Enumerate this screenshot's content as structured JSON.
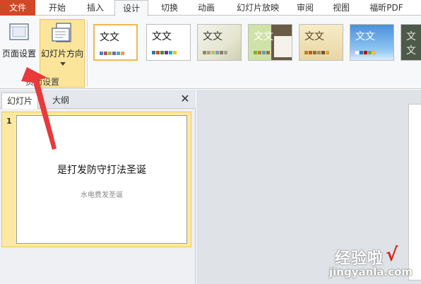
{
  "ribbon": {
    "tabs": [
      {
        "label": "文件"
      },
      {
        "label": "开始"
      },
      {
        "label": "插入"
      },
      {
        "label": "设计"
      },
      {
        "label": "切换"
      },
      {
        "label": "动画"
      },
      {
        "label": "幻灯片放映"
      },
      {
        "label": "审阅"
      },
      {
        "label": "视图"
      },
      {
        "label": "福昕PDF"
      }
    ],
    "active_tab": "设计",
    "page_setup_label": "页面设置",
    "orientation_label": "幻灯片方向",
    "group_label": "页面设置",
    "themes": [
      {
        "text": "文文"
      },
      {
        "text": "文文"
      },
      {
        "text": "文文"
      },
      {
        "text": "文文"
      },
      {
        "text": "文文"
      },
      {
        "text": "文文"
      },
      {
        "text": "文文"
      }
    ]
  },
  "panel": {
    "tabs": [
      {
        "label": "幻灯片"
      },
      {
        "label": "大纲"
      }
    ],
    "close_glyph": "✕"
  },
  "slides": [
    {
      "number": "1",
      "title": "是打发防守打法圣诞",
      "subtitle": "水电费发圣诞"
    }
  ],
  "watermark": {
    "brand": "经验啦",
    "check": "√",
    "url": "jingyanla.com"
  },
  "colors": {
    "file_tab": "#d24726",
    "selected_highlight": "#fde9a2",
    "arrow": "#e8393b"
  }
}
